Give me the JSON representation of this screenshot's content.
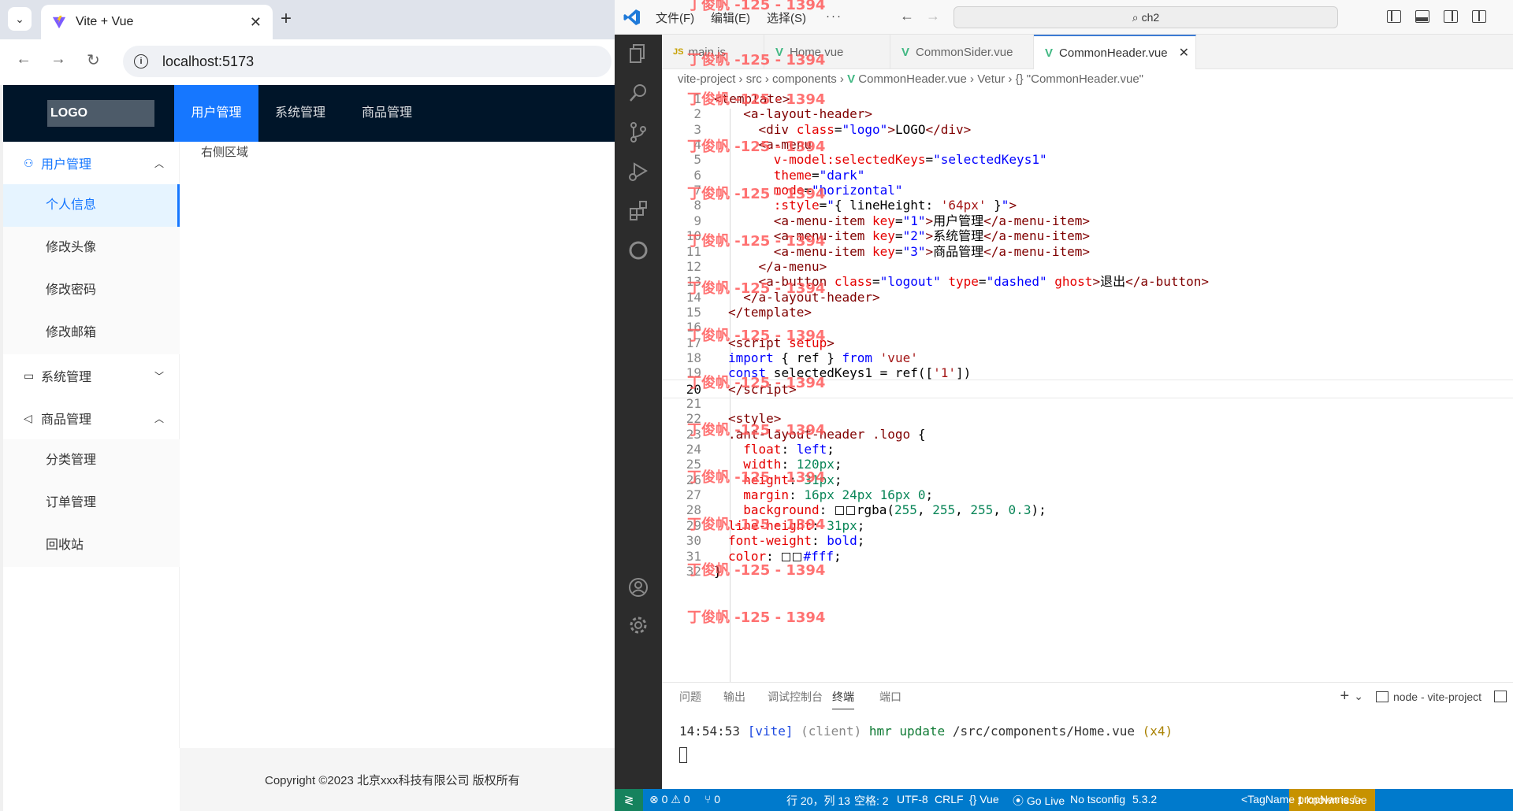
{
  "browser": {
    "tab_title": "Vite + Vue",
    "url": "localhost:5173"
  },
  "app": {
    "logo": "LOGO",
    "top_menu": [
      "用户管理",
      "系统管理",
      "商品管理"
    ],
    "sider": {
      "user": {
        "title": "用户管理",
        "items": [
          "个人信息",
          "修改头像",
          "修改密码",
          "修改邮箱"
        ]
      },
      "system": {
        "title": "系统管理"
      },
      "product": {
        "title": "商品管理",
        "items": [
          "分类管理",
          "订单管理",
          "回收站"
        ]
      }
    },
    "content": "右侧区域",
    "footer": "Copyright ©2023 北京xxx科技有限公司 版权所有"
  },
  "vscode": {
    "menu": [
      "文件(F)",
      "编辑(E)",
      "选择(S)",
      "···"
    ],
    "search": "ch2",
    "tabs": [
      {
        "label": "main.js",
        "type": "JS"
      },
      {
        "label": "Home.vue",
        "type": "vue"
      },
      {
        "label": "CommonSider.vue",
        "type": "vue"
      },
      {
        "label": "CommonHeader.vue",
        "type": "vue"
      }
    ],
    "breadcrumb": {
      "project": "vite-project",
      "src": "src",
      "components": "components",
      "file": "CommonHeader.vue",
      "vetur": "Vetur",
      "symbol": "{} \"CommonHeader.vue\""
    },
    "line_numbers": [
      "1",
      "2",
      "3",
      "4",
      "5",
      "6",
      "7",
      "8",
      "9",
      "10",
      "11",
      "12",
      "13",
      "14",
      "15",
      "16",
      "17",
      "18",
      "19",
      "20",
      "21",
      "22",
      "23",
      "24",
      "25",
      "26",
      "27",
      "28",
      "29",
      "30",
      "31",
      "32"
    ],
    "panel_tabs": [
      "问题",
      "输出",
      "调试控制台",
      "终端",
      "端口"
    ],
    "terminal_name": "node - vite-project",
    "terminal": {
      "time": "14:54:53",
      "tag": "[vite]",
      "client": "(client)",
      "cmd": "hmr update",
      "path": "/src/components/Home.vue",
      "count": "(x4)"
    },
    "status": {
      "errors": "⊗ 0 ⚠ 0",
      "ports": "⑂ 0",
      "position": "行 20，列 13",
      "spaces": "空格: 2",
      "encoding": "UTF-8",
      "eol": "CRLF",
      "language": "{} Vue",
      "golive": "Go Live",
      "tsconfig": "No tsconfig",
      "version": "5.3.2",
      "known_issue": "1 known issue",
      "tagname": "<TagName propName />"
    }
  },
  "watermark": "丁俊帆 -125 - 1394"
}
